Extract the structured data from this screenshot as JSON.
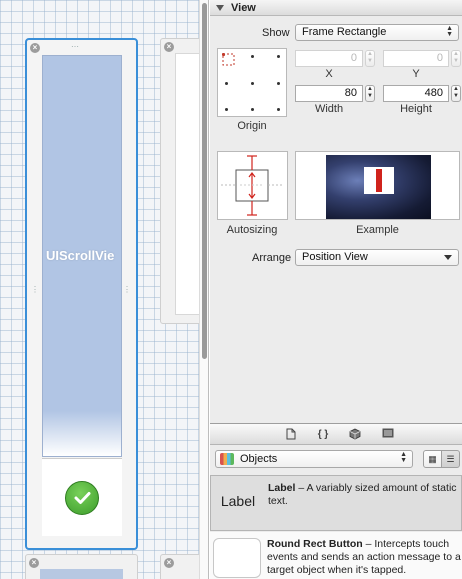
{
  "canvas": {
    "scroll_view_label": "UIScrollVie"
  },
  "inspector": {
    "section_title": "View",
    "show_label": "Show",
    "show_value": "Frame Rectangle",
    "x_label": "X",
    "y_label": "Y",
    "x_value": "0",
    "y_value": "0",
    "width_label": "Width",
    "height_label": "Height",
    "width_value": "80",
    "height_value": "480",
    "origin_label": "Origin",
    "autosizing_label": "Autosizing",
    "example_label": "Example",
    "arrange_label": "Arrange",
    "arrange_value": "Position View"
  },
  "library": {
    "tab_icons": [
      "file-icon",
      "braces-icon",
      "cube-icon",
      "media-icon"
    ],
    "objects_value": "Objects",
    "items": [
      {
        "thumb": "Label",
        "title": "Label",
        "desc": " – A variably sized amount of static text."
      },
      {
        "thumb": "",
        "title": "Round Rect Button",
        "desc": " – Intercepts touch events and sends an action message to a target object when it's tapped."
      }
    ]
  },
  "colors": {
    "selection_blue": "#3a8fd8",
    "scroll_view_fill": "#b1c5e4",
    "check_green": "#4caf3a",
    "autosizing_red": "#d0231c"
  }
}
